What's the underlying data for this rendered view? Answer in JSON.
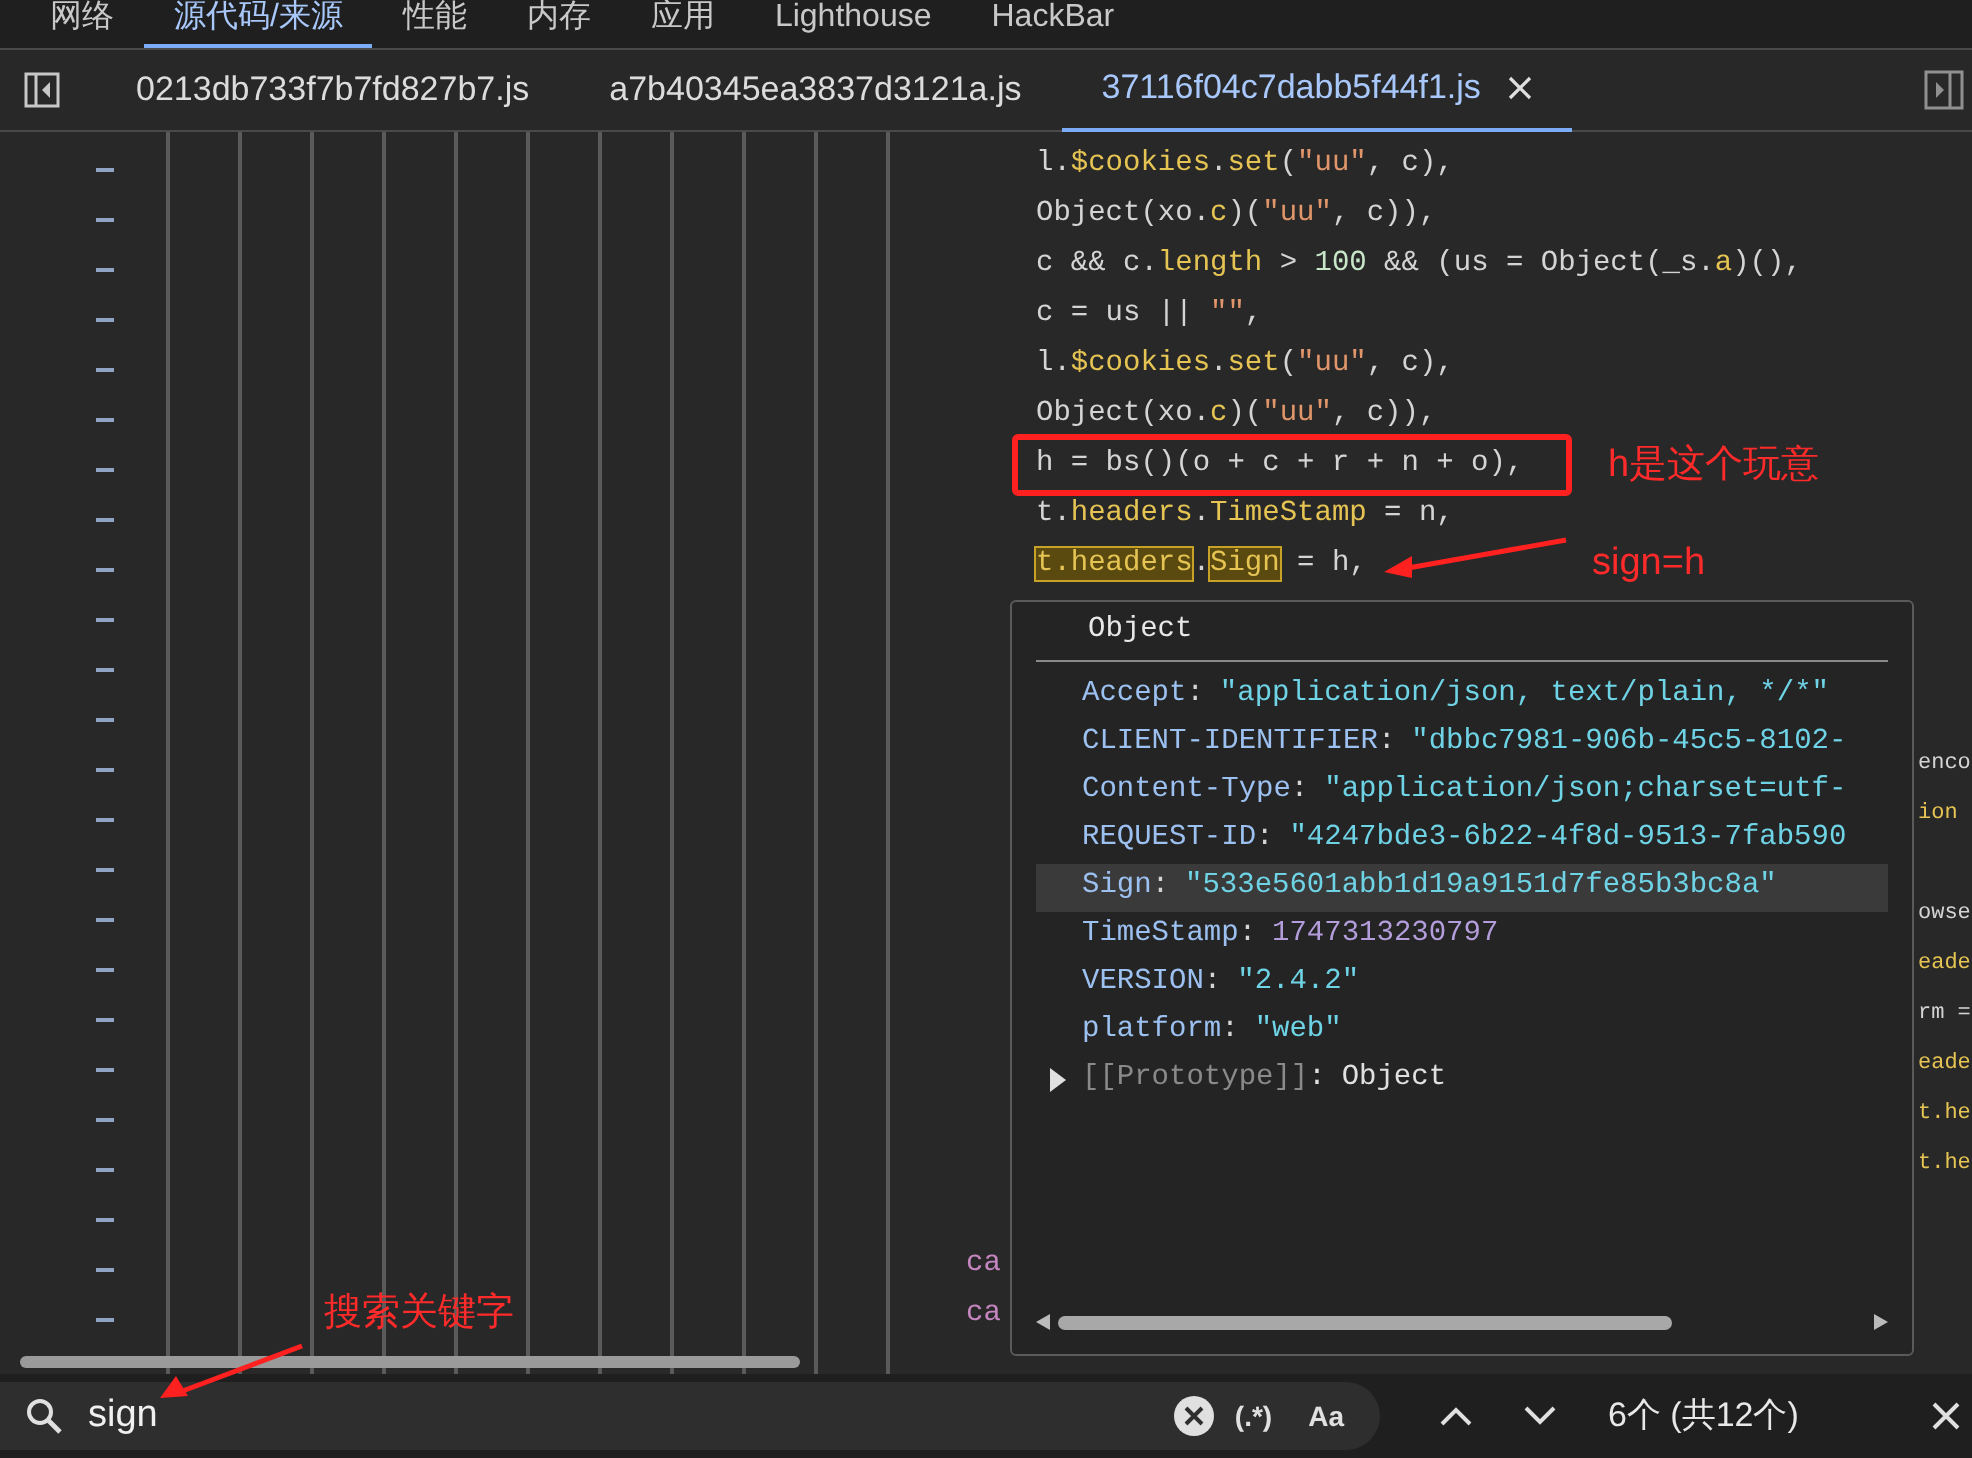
{
  "panel_tabs": [
    {
      "label": "网络",
      "selected": false
    },
    {
      "label": "源代码/来源",
      "selected": true
    },
    {
      "label": "性能",
      "selected": false
    },
    {
      "label": "内存",
      "selected": false
    },
    {
      "label": "应用",
      "selected": false
    },
    {
      "label": "Lighthouse",
      "selected": false
    },
    {
      "label": "HackBar",
      "selected": false
    }
  ],
  "file_tabs": [
    {
      "label": "0213db733f7b7fd827b7.js",
      "selected": false
    },
    {
      "label": "a7b40345ea3837d3121a.js",
      "selected": false
    },
    {
      "label": "37116f04c7dabb5f44f1.js",
      "selected": true
    }
  ],
  "code_lines": [
    [
      {
        "kind": "plain",
        "text": "l."
      },
      {
        "kind": "prop",
        "text": "$cookies"
      },
      {
        "kind": "plain",
        "text": "."
      },
      {
        "kind": "prop",
        "text": "set"
      },
      {
        "kind": "plain",
        "text": "("
      },
      {
        "kind": "string",
        "text": "\"uu\""
      },
      {
        "kind": "plain",
        "text": ", c),"
      }
    ],
    [
      {
        "kind": "plain",
        "text": "Object(xo."
      },
      {
        "kind": "prop",
        "text": "c"
      },
      {
        "kind": "plain",
        "text": ")("
      },
      {
        "kind": "string",
        "text": "\"uu\""
      },
      {
        "kind": "plain",
        "text": ", c)),"
      }
    ],
    [
      {
        "kind": "plain",
        "text": "c && c."
      },
      {
        "kind": "prop",
        "text": "length"
      },
      {
        "kind": "plain",
        "text": " > "
      },
      {
        "kind": "number",
        "text": "100"
      },
      {
        "kind": "plain",
        "text": " && (us = Object(_s."
      },
      {
        "kind": "prop",
        "text": "a"
      },
      {
        "kind": "plain",
        "text": ")(),"
      }
    ],
    [
      {
        "kind": "plain",
        "text": "c = us || "
      },
      {
        "kind": "string",
        "text": "\"\""
      },
      {
        "kind": "plain",
        "text": ","
      }
    ],
    [
      {
        "kind": "plain",
        "text": "l."
      },
      {
        "kind": "prop",
        "text": "$cookies"
      },
      {
        "kind": "plain",
        "text": "."
      },
      {
        "kind": "prop",
        "text": "set"
      },
      {
        "kind": "plain",
        "text": "("
      },
      {
        "kind": "string",
        "text": "\"uu\""
      },
      {
        "kind": "plain",
        "text": ", c),"
      }
    ],
    [
      {
        "kind": "plain",
        "text": "Object(xo."
      },
      {
        "kind": "prop",
        "text": "c"
      },
      {
        "kind": "plain",
        "text": ")("
      },
      {
        "kind": "string",
        "text": "\"uu\""
      },
      {
        "kind": "plain",
        "text": ", c)),"
      }
    ],
    [
      {
        "kind": "plain",
        "text": "h = bs()(o + c + r + n + o),"
      }
    ],
    [
      {
        "kind": "plain",
        "text": "t."
      },
      {
        "kind": "prop",
        "text": "headers"
      },
      {
        "kind": "plain",
        "text": "."
      },
      {
        "kind": "prop",
        "text": "TimeStamp"
      },
      {
        "kind": "plain",
        "text": " = n,"
      }
    ],
    [
      {
        "kind": "match",
        "text": "t.headers"
      },
      {
        "kind": "plain",
        "text": "."
      },
      {
        "kind": "match",
        "text": "Sign"
      },
      {
        "kind": "plain",
        "text": " = h,"
      }
    ]
  ],
  "right_fragments": [
    {
      "kind": "plain",
      "text": "enco"
    },
    {
      "kind": "prop",
      "text": "ion"
    },
    {
      "kind": "plain",
      "text": "owse"
    },
    {
      "kind": "prop",
      "text": "eade"
    },
    {
      "kind": "plain",
      "text": "rm ="
    },
    {
      "kind": "prop",
      "text": "eade"
    },
    {
      "kind": "prop",
      "text": "t.he"
    },
    {
      "kind": "prop",
      "text": "t.he"
    }
  ],
  "lower_fragments": [
    "ca",
    "ca"
  ],
  "popover": {
    "title": "Object",
    "separator": ":",
    "properties": [
      {
        "key": "Accept",
        "value": "\"application/json, text/plain, */*\"",
        "kind": "string",
        "selected": false
      },
      {
        "key": "CLIENT-IDENTIFIER",
        "value": "\"dbbc7981-906b-45c5-8102-",
        "kind": "string",
        "selected": false
      },
      {
        "key": "Content-Type",
        "value": "\"application/json;charset=utf-",
        "kind": "string",
        "selected": false
      },
      {
        "key": "REQUEST-ID",
        "value": "\"4247bde3-6b22-4f8d-9513-7fab590",
        "kind": "string",
        "selected": false
      },
      {
        "key": "Sign",
        "value": "\"533e5601abb1d19a9151d7fe85b3bc8a\"",
        "kind": "string",
        "selected": true
      },
      {
        "key": "TimeStamp",
        "value": "1747313230797",
        "kind": "number",
        "selected": false
      },
      {
        "key": "VERSION",
        "value": "\"2.4.2\"",
        "kind": "string",
        "selected": false
      },
      {
        "key": "platform",
        "value": "\"web\"",
        "kind": "string",
        "selected": false
      }
    ],
    "prototype": {
      "key": "[[Prototype]]",
      "value": "Object",
      "expanded": false
    }
  },
  "annotations": {
    "box_note": "h是这个玩意",
    "arrow_note": "sign=h",
    "search_note": "搜索关键字"
  },
  "search": {
    "value": "sign",
    "regex_label": "(.*)",
    "case_label": "Aa",
    "count": "6个 (共12个)"
  }
}
